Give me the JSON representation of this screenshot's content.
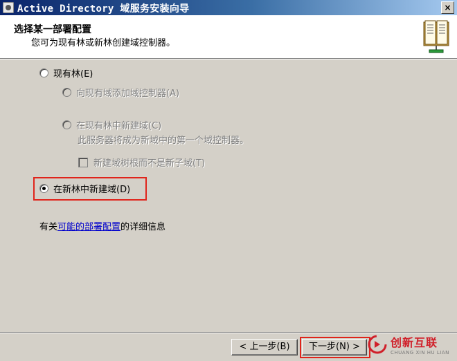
{
  "window": {
    "title": "Active Directory 域服务安装向导",
    "close_glyph": "×",
    "icon": "app-icon"
  },
  "header": {
    "title": "选择某一部署配置",
    "subtitle": "您可为现有林或新林创建域控制器。",
    "icon": "book-icon"
  },
  "options": {
    "existing_forest": {
      "label": "现有林(E)",
      "checked": false,
      "enabled": true
    },
    "add_dc": {
      "label": "向现有域添加域控制器(A)",
      "checked": false,
      "enabled": false
    },
    "new_domain": {
      "label": "在现有林中新建域(C)",
      "checked": false,
      "enabled": false
    },
    "new_domain_desc": "此服务器将成为新域中的第一个域控制器。",
    "tree_root": {
      "label": "新建域树根而不是新子域(T)",
      "checked": false,
      "enabled": false
    },
    "new_forest": {
      "label": "在新林中新建域(D)",
      "checked": true,
      "enabled": true
    }
  },
  "info": {
    "prefix": "有关",
    "link": "可能的部署配置",
    "suffix": "的详细信息"
  },
  "buttons": {
    "back": "< 上一步(B)",
    "next": "下一步(N) >"
  },
  "watermark": {
    "main": "创新互联",
    "sub": "CHUANG XIN HU LIAN"
  },
  "colors": {
    "title_bar": "#0a246a",
    "highlight": "#e0241b",
    "link": "#0000cc",
    "dialog_bg": "#d4d0c8"
  }
}
